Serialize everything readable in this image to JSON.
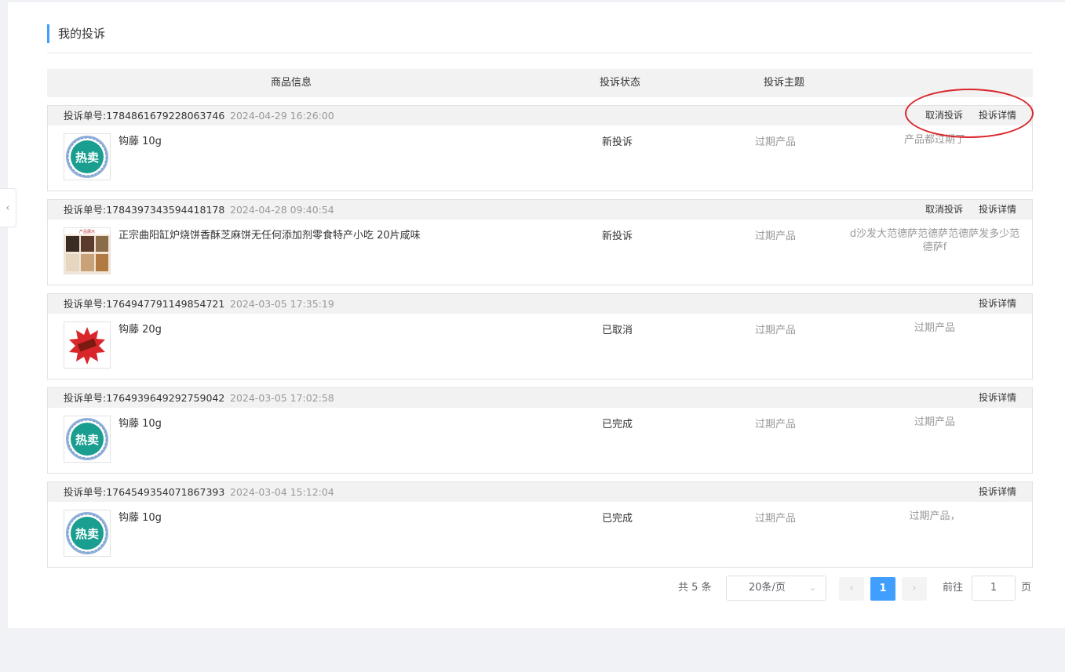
{
  "page": {
    "title": "我的投诉"
  },
  "columns": {
    "product": "商品信息",
    "status": "投诉状态",
    "subject": "投诉主题"
  },
  "orders": [
    {
      "no_label": "投诉单号:1784861679228063746",
      "time": "2024-04-29 16:26:00",
      "cancel": "取消投诉",
      "detail": "投诉详情",
      "product": "钩藤 10g",
      "status": "新投诉",
      "subject": "过期产品",
      "desc": "产品都过期了",
      "thumb": "hot-badge"
    },
    {
      "no_label": "投诉单号:1784397343594418178",
      "time": "2024-04-28 09:40:54",
      "cancel": "取消投诉",
      "detail": "投诉详情",
      "product": "正宗曲阳缸炉烧饼香酥芝麻饼无任何添加剂零食特产小吃 20片咸味",
      "status": "新投诉",
      "subject": "过期产品",
      "desc": "d沙发大范德萨范德萨范德萨发多少范德萨f",
      "thumb": "food-photo"
    },
    {
      "no_label": "投诉单号:1764947791149854721",
      "time": "2024-03-05 17:35:19",
      "detail": "投诉详情",
      "product": "钩藤 20g",
      "status": "已取消",
      "subject": "过期产品",
      "desc": "过期产品",
      "thumb": "red-badge"
    },
    {
      "no_label": "投诉单号:1764939649292759042",
      "time": "2024-03-05 17:02:58",
      "detail": "投诉详情",
      "product": "钩藤 10g",
      "status": "已完成",
      "subject": "过期产品",
      "desc": "过期产品",
      "thumb": "hot-badge"
    },
    {
      "no_label": "投诉单号:1764549354071867393",
      "time": "2024-03-04 15:12:04",
      "detail": "投诉详情",
      "product": "钩藤 10g",
      "status": "已完成",
      "subject": "过期产品",
      "desc": "过期产品，",
      "thumb": "hot-badge"
    }
  ],
  "thumb_text": {
    "hot": "热卖",
    "small_banner": "产品展示"
  },
  "pagination": {
    "total": "共 5 条",
    "page_size": "20条/页",
    "current": "1",
    "goto_label": "前往",
    "goto_value": "1",
    "page_suffix": "页"
  },
  "colors": {
    "accent": "#409eff",
    "annotation": "#d9262b"
  }
}
